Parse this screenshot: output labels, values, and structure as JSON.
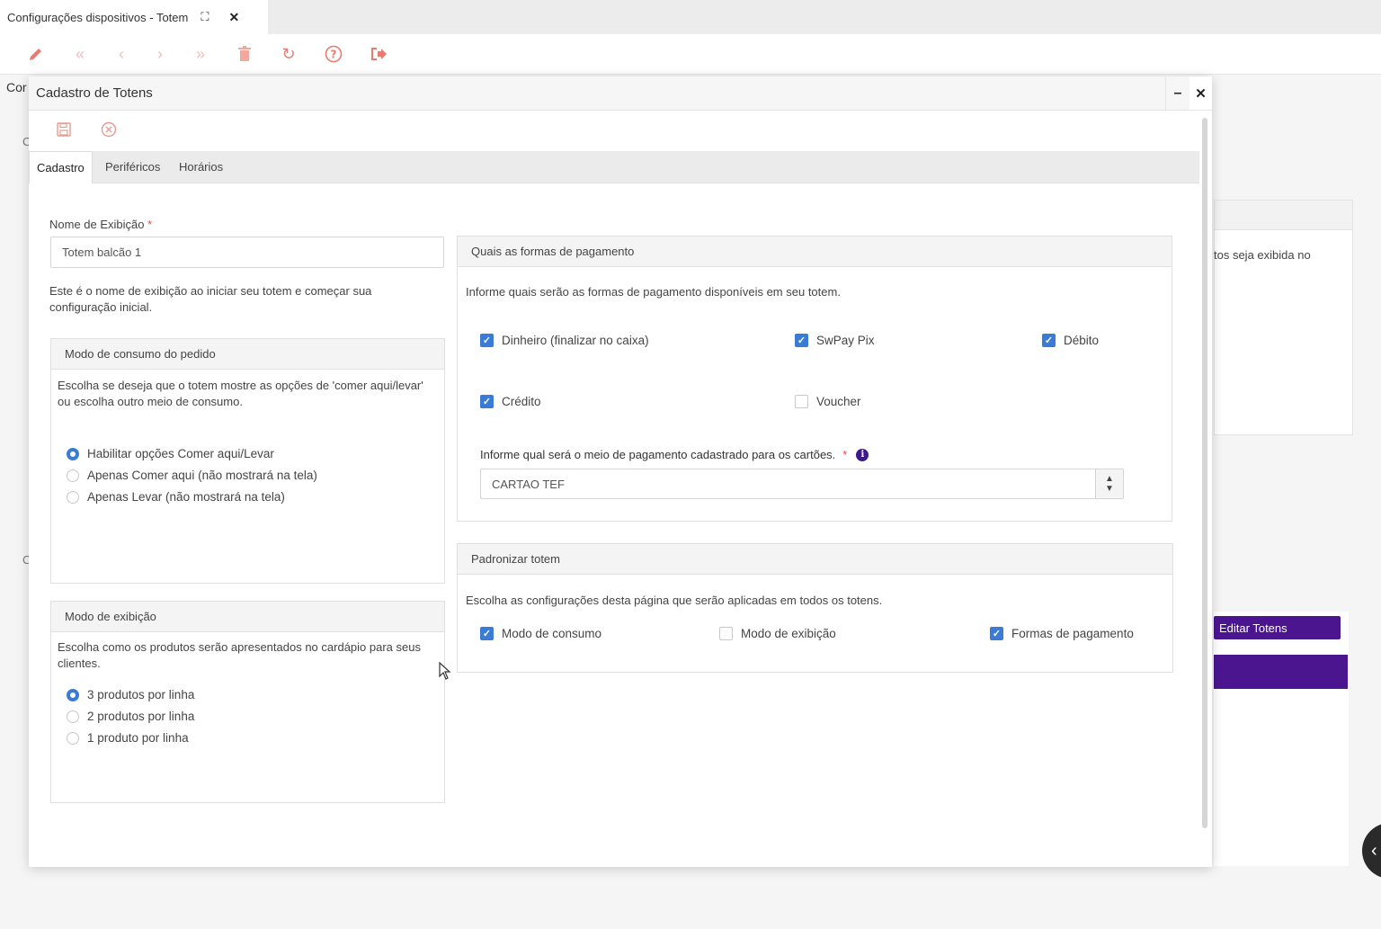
{
  "app": {
    "tab_label": "Configurações dispositivos - Totem",
    "tab_expand_icon": "expand-icon",
    "tab_close_glyph": "✕",
    "toolbar_icons": [
      "pencil-icon",
      "first-page-icon",
      "prev-icon",
      "next-icon",
      "last-page-icon",
      "trash-icon",
      "refresh-icon",
      "help-icon",
      "exit-icon"
    ],
    "bg_heading": "Cor",
    "bg_side_c1": "C",
    "bg_side_c2": "C",
    "bg_card_text": "tos seja exibida no",
    "bg_edit_button": "Editar Totens",
    "accent_color": "#4b1590"
  },
  "modal": {
    "title": "Cadastro de Totens",
    "minimize_glyph": "–",
    "close_glyph": "✕",
    "tabs": [
      "Cadastro",
      "Periféricos",
      "Horários"
    ],
    "nome": {
      "label": "Nome de Exibição",
      "required_mark": "*",
      "value": "Totem balcão 1",
      "help": "Este é o nome de exibição ao iniciar seu totem e começar sua configuração inicial."
    },
    "modo_consumo": {
      "title": "Modo de consumo do pedido",
      "help": "Escolha se deseja que o totem mostre as opções de 'comer aqui/levar' ou escolha outro meio de consumo.",
      "options": [
        "Habilitar opções Comer aqui/Levar",
        "Apenas Comer aqui (não mostrará na tela)",
        "Apenas Levar (não mostrará na tela)"
      ],
      "selected": 0
    },
    "modo_exibicao": {
      "title": "Modo de exibição",
      "help": "Escolha como os produtos serão apresentados no cardápio para seus clientes.",
      "options": [
        "3 produtos por linha",
        "2 produtos por linha",
        "1 produto por linha"
      ],
      "selected": 0
    },
    "pagamento": {
      "title": "Quais as formas de pagamento",
      "help": "Informe quais serão as formas de pagamento disponíveis em seu totem.",
      "options": [
        {
          "label": "Dinheiro (finalizar no caixa)",
          "checked": true
        },
        {
          "label": "SwPay Pix",
          "checked": true
        },
        {
          "label": "Débito",
          "checked": true
        },
        {
          "label": "Crédito",
          "checked": true
        },
        {
          "label": "Voucher",
          "checked": false
        }
      ],
      "meio_label": "Informe qual será o meio de pagamento cadastrado para os cartões.",
      "meio_required": "*",
      "meio_value": "CARTAO TEF"
    },
    "padronizar": {
      "title": "Padronizar totem",
      "help": "Escolha as configurações desta página que serão aplicadas em todos os totens.",
      "options": [
        {
          "label": "Modo de consumo",
          "checked": true
        },
        {
          "label": "Modo de exibição",
          "checked": false
        },
        {
          "label": "Formas de pagamento",
          "checked": true
        }
      ]
    },
    "check_color": "#3a7bd5"
  }
}
